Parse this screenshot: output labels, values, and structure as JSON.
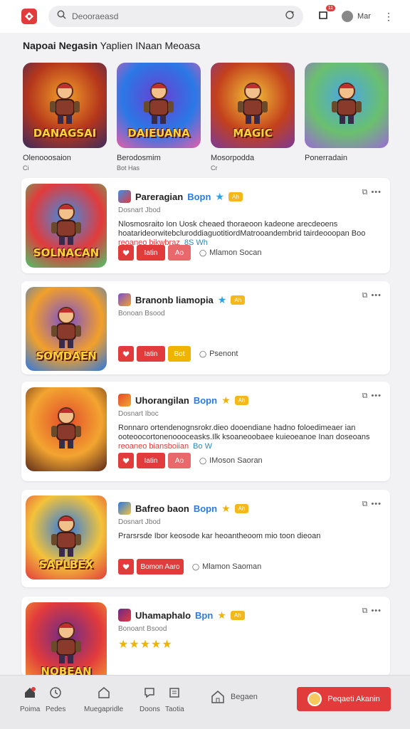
{
  "topbar": {
    "search_placeholder": "Deooraeasd",
    "notification_count": "11",
    "user_label": "Mar"
  },
  "section": {
    "title_bold": "Napoai Negasin",
    "title_rest": "Yaplien INaan Meoasa"
  },
  "featured": [
    {
      "name": "Olenooosaion",
      "sub": "Ci",
      "art_text": "DANAGSAI",
      "colors": [
        "#f2a02a",
        "#b5361b",
        "#3b2b5e"
      ]
    },
    {
      "name": "Berodosmim",
      "sub": "Bot Has",
      "art_text": "DAIEUANA",
      "colors": [
        "#6b3fd0",
        "#2a78e6",
        "#e85ea8"
      ]
    },
    {
      "name": "Mosorpodda",
      "sub": "Cr",
      "art_text": "MAGIC",
      "colors": [
        "#f3c33a",
        "#c3401c",
        "#7a3a99"
      ]
    },
    {
      "name": "Ponerradain",
      "sub": "",
      "art_text": "",
      "colors": [
        "#4aa5e8",
        "#6ac06e",
        "#9a6ad6"
      ]
    }
  ],
  "cards": [
    {
      "title": "Pareragian",
      "title_extra": "Bopn",
      "tag": "Ah",
      "star_color": "blue",
      "subtitle": "Dosnart Jbod",
      "desc": "Nlosmosraito Ion Uosk cheaed thoraeoon kadeone arecdeoens hoatarideorwitebcluroddiaguotitiordMatrooandembrid tairdeooopan Boo",
      "tags": "reoaneo bikwbraz",
      "tags_extra": "8S Wh",
      "buttons": [
        "",
        "Iatin",
        "Ao"
      ],
      "meta": "Mlamon Socan",
      "art_text": "SOLNACAN",
      "colors": [
        "#3b8ee8",
        "#e23b3b",
        "#4cc46a"
      ],
      "rating": ""
    },
    {
      "title": "Branonb liamopia",
      "title_extra": "",
      "tag": "Ah",
      "star_color": "blue",
      "subtitle": "Bonoan Bsood",
      "desc": "",
      "tags": "",
      "tags_extra": "",
      "buttons": [
        "",
        "Iatin",
        "Bot"
      ],
      "meta": "Psenont",
      "art_text": "SOMDAEN",
      "colors": [
        "#7a4fd0",
        "#f2a02a",
        "#2a78e6"
      ],
      "rating": ""
    },
    {
      "title": "Uhorangilan",
      "title_extra": "Bopn",
      "tag": "Ah",
      "star_color": "gold",
      "subtitle": "Dosnart Iboc",
      "desc": "Ronnaro ortendenognsrokr.dieo dooendiane hadno foloedimeaer ian ooteoocortonenoooceasks.Ilk  ksoaneoobaee kuieoeanoe Inan doseoans",
      "tags": "reoaneo biansboiian",
      "tags_extra": "Bo W",
      "buttons": [
        "",
        "Iatin",
        "Ao"
      ],
      "meta": "IMoson Saoran",
      "art_text": "",
      "colors": [
        "#e24b2b",
        "#f3a530",
        "#5a2a1a"
      ],
      "rating": ""
    },
    {
      "title": "Bafreo baon",
      "title_extra": "Bopn",
      "tag": "Ah",
      "star_color": "gold",
      "subtitle": "Dosnart Jbod",
      "desc": "Prarsrsde Ibor keosode kar heoantheoom mio toon dieoan",
      "tags": "",
      "tags_extra": "",
      "buttons": [
        "",
        "Bomon Aaro"
      ],
      "meta": "Mlamon Saoman",
      "art_text": "SAPLBEX",
      "colors": [
        "#2a78e6",
        "#f3c33a",
        "#e23b3b"
      ],
      "rating": ""
    },
    {
      "title": "Uhamaphalo",
      "title_extra": "Bpn",
      "tag": "Ah",
      "star_color": "gold",
      "subtitle": "Bonoant Bsood",
      "desc": "",
      "tags": "",
      "tags_extra": "",
      "buttons": [],
      "meta": "",
      "art_text": "NOBEAN",
      "colors": [
        "#6a2a8a",
        "#e23b3b",
        "#f3a530"
      ],
      "rating": "★★★★★"
    }
  ],
  "bottomnav": {
    "items": [
      "Poima",
      "Pedes",
      "Muegapridle",
      "Doons",
      "Taotia"
    ],
    "center": "Begaen",
    "cta": "Peqaeti Akanin"
  },
  "colors": {
    "accent": "#e23b3b",
    "gold": "#f0b400",
    "blue": "#2a7be6"
  }
}
